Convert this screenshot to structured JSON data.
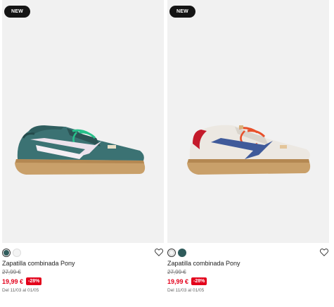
{
  "products": [
    {
      "badge": "NEW",
      "name": "Zapatilla combinada Pony",
      "old_price": "27,99 €",
      "price": "19,99 €",
      "discount": "-28%",
      "dates": "Del 11/03 al 01/05",
      "colors": [
        "#2f5b5b",
        "#f2f2f2"
      ],
      "selected_color": 0,
      "heart_icon": "heart-outline-icon"
    },
    {
      "badge": "NEW",
      "name": "Zapatilla combinada Pony",
      "old_price": "27,99 €",
      "price": "19,99 €",
      "discount": "-28%",
      "dates": "Del 11/03 al 01/05",
      "colors": [
        "#f2f2f2",
        "#2f5b5b"
      ],
      "selected_color": 0,
      "heart_icon": "heart-outline-icon"
    }
  ],
  "accent_color": "#e3001b"
}
